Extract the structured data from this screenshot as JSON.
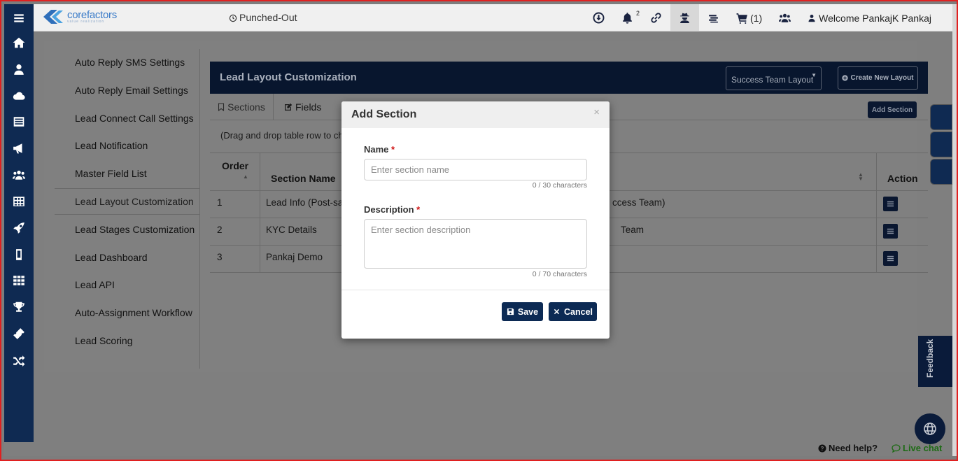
{
  "topbar": {
    "logo_name": "corefactors",
    "logo_tag": "value realization",
    "punch_status": "Punched-Out",
    "notification_count": "2",
    "cart_label": "(1)",
    "welcome": "Welcome PankajK Pankaj"
  },
  "menu": {
    "items": [
      "Auto Reply SMS Settings",
      "Auto Reply Email Settings",
      "Lead Connect Call Settings",
      "Lead Notification",
      "Master Field List",
      "Lead Layout Customization",
      "Lead Stages Customization",
      "Lead Dashboard",
      "Lead API",
      "Auto-Assignment Workflow",
      "Lead Scoring"
    ],
    "active_index": 5
  },
  "panel": {
    "title": "Lead Layout Customization",
    "layout_select": "Success Team Layout",
    "create_button": "Create New Layout",
    "tabs": [
      "Sections",
      "Fields"
    ],
    "add_section_button": "Add Section",
    "drag_note": "(Drag and drop table row to cha"
  },
  "table": {
    "headers": [
      "Order",
      "Section Name",
      "Action"
    ],
    "rows": [
      {
        "order": "1",
        "name": "Lead Info (Post-sales)",
        "extra": "ccess Team)"
      },
      {
        "order": "2",
        "name": "KYC Details",
        "extra": "Team"
      },
      {
        "order": "3",
        "name": "Pankaj Demo",
        "extra": ""
      }
    ]
  },
  "modal": {
    "title": "Add Section",
    "close": "×",
    "name_label": "Name",
    "name_placeholder": "Enter section name",
    "name_counter": "0 / 30 characters",
    "desc_label": "Description",
    "desc_placeholder": "Enter section description",
    "desc_counter": "0 / 70 characters",
    "required_mark": "*",
    "save": "Save",
    "cancel": "Cancel"
  },
  "widgets": {
    "feedback": "Feedback",
    "need_help": "Need help?",
    "live_chat": "Live chat"
  },
  "colors": {
    "sidebar": "#0f2a52",
    "primary_button": "#0c2a54",
    "required": "#d01515",
    "live_chat": "#1e6b15"
  }
}
